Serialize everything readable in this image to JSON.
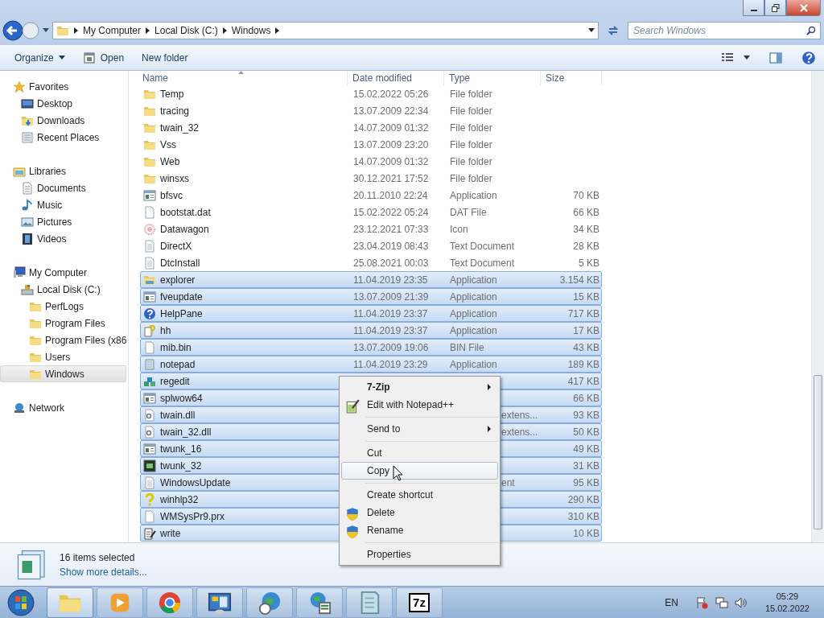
{
  "address": {
    "crumbs": [
      "My Computer",
      "Local Disk (C:)",
      "Windows"
    ]
  },
  "search": {
    "placeholder": "Search Windows"
  },
  "toolbar": {
    "items": [
      {
        "label": "Organize",
        "kind": "menu"
      },
      {
        "label": "Open",
        "kind": "open"
      },
      {
        "label": "New folder",
        "kind": "plain"
      }
    ]
  },
  "sidebar": {
    "groups": [
      {
        "label": "Favorites",
        "kind": "star",
        "selected": false,
        "children": [
          {
            "label": "Desktop",
            "kind": "desktop",
            "selected": false
          },
          {
            "label": "Downloads",
            "kind": "downloads",
            "selected": false
          },
          {
            "label": "Recent Places",
            "kind": "recent",
            "selected": false
          }
        ]
      },
      {
        "label": "Libraries",
        "kind": "library",
        "selected": false,
        "children": [
          {
            "label": "Documents",
            "kind": "documents",
            "selected": false
          },
          {
            "label": "Music",
            "kind": "music",
            "selected": false
          },
          {
            "label": "Pictures",
            "kind": "pictures",
            "selected": false
          },
          {
            "label": "Videos",
            "kind": "videos",
            "selected": false
          }
        ]
      },
      {
        "label": "My Computer",
        "kind": "computer",
        "selected": false,
        "children": [
          {
            "label": "Local Disk (C:)",
            "kind": "drive",
            "selected": false,
            "children": [
              {
                "label": "PerfLogs",
                "kind": "folder",
                "selected": false
              },
              {
                "label": "Program Files",
                "kind": "folder",
                "selected": false
              },
              {
                "label": "Program Files (x86",
                "kind": "folder",
                "selected": false
              },
              {
                "label": "Users",
                "kind": "folder",
                "selected": false
              },
              {
                "label": "Windows",
                "kind": "folder",
                "selected": true
              }
            ]
          }
        ]
      },
      {
        "label": "Network",
        "kind": "network",
        "selected": false
      }
    ]
  },
  "table": {
    "columns": [
      "Name",
      "Date modified",
      "Type",
      "Size"
    ],
    "rows": [
      {
        "name": "Temp",
        "kind": "folder",
        "date": "15.02.2022 05:26",
        "type": "File folder",
        "selected": false
      },
      {
        "name": "tracing",
        "kind": "folder",
        "date": "13.07.2009 22:34",
        "type": "File folder",
        "selected": false
      },
      {
        "name": "twain_32",
        "kind": "folder",
        "date": "14.07.2009 01:32",
        "type": "File folder",
        "selected": false
      },
      {
        "name": "Vss",
        "kind": "folder",
        "date": "13.07.2009 23:20",
        "type": "File folder",
        "selected": false
      },
      {
        "name": "Web",
        "kind": "folder",
        "date": "14.07.2009 01:32",
        "type": "File folder",
        "selected": false
      },
      {
        "name": "winsxs",
        "kind": "folder",
        "date": "30.12.2021 17:52",
        "type": "File folder",
        "selected": false
      },
      {
        "name": "bfsvc",
        "kind": "app",
        "date": "20.11.2010 22:24",
        "type": "Application",
        "size": "70 KB",
        "selected": false
      },
      {
        "name": "bootstat.dat",
        "kind": "file",
        "date": "15.02.2022 05:24",
        "type": "DAT File",
        "size": "66 KB",
        "selected": false
      },
      {
        "name": "Datawagon",
        "kind": "burst",
        "date": "23.12.2021 07:33",
        "type": "Icon",
        "size": "34 KB",
        "selected": false
      },
      {
        "name": "DirectX",
        "kind": "text",
        "date": "23.04.2019 08:43",
        "type": "Text Document",
        "size": "28 KB",
        "selected": false
      },
      {
        "name": "DtcInstall",
        "kind": "text",
        "date": "25.08.2021 00:03",
        "type": "Text Document",
        "size": "5 KB",
        "selected": false
      },
      {
        "name": "explorer",
        "kind": "explorer",
        "date": "11.04.2019 23:35",
        "type": "Application",
        "size": "3.154 KB",
        "selected": true
      },
      {
        "name": "fveupdate",
        "kind": "app",
        "date": "13.07.2009 21:39",
        "type": "Application",
        "size": "15 KB",
        "selected": true
      },
      {
        "name": "HelpPane",
        "kind": "help",
        "date": "11.04.2019 23:37",
        "type": "Application",
        "size": "717 KB",
        "selected": true
      },
      {
        "name": "hh",
        "kind": "hh",
        "date": "11.04.2019 23:37",
        "type": "Application",
        "size": "17 KB",
        "selected": true
      },
      {
        "name": "mib.bin",
        "kind": "file",
        "date": "13.07.2009 19:06",
        "type": "BIN File",
        "size": "43 KB",
        "selected": true
      },
      {
        "name": "notepad",
        "kind": "notepad",
        "date": "11.04.2019 23:29",
        "type": "Application",
        "size": "189 KB",
        "selected": true
      },
      {
        "name": "regedit",
        "kind": "regedit",
        "size": "417 KB",
        "selected": true
      },
      {
        "name": "splwow64",
        "kind": "app",
        "size": "66 KB",
        "selected": true
      },
      {
        "name": "twain.dll",
        "kind": "dll",
        "type": "extens...",
        "size": "93 KB",
        "selected": true
      },
      {
        "name": "twain_32.dll",
        "kind": "dll",
        "type": "extens...",
        "size": "50 KB",
        "selected": true
      },
      {
        "name": "twunk_16",
        "kind": "app",
        "size": "49 KB",
        "selected": true
      },
      {
        "name": "twunk_32",
        "kind": "terminal",
        "size": "31 KB",
        "selected": true
      },
      {
        "name": "WindowsUpdate",
        "kind": "text",
        "type": "ent",
        "size": "95 KB",
        "selected": true
      },
      {
        "name": "winhlp32",
        "kind": "question",
        "size": "290 KB",
        "selected": true
      },
      {
        "name": "WMSysPr9.prx",
        "kind": "file",
        "size": "310 KB",
        "selected": true
      },
      {
        "name": "write",
        "kind": "write",
        "size": "10 KB",
        "selected": true
      }
    ]
  },
  "context_menu": {
    "items": [
      {
        "label": "7-Zip",
        "kind": "submenu",
        "bold": true,
        "selected": false
      },
      {
        "label": "Edit with Notepad++",
        "kind": "notepadpp",
        "selected": false
      },
      {
        "kind": "separator"
      },
      {
        "label": "Send to",
        "kind": "submenu",
        "selected": false
      },
      {
        "kind": "separator"
      },
      {
        "label": "Cut",
        "kind": "plain",
        "selected": false
      },
      {
        "label": "Copy",
        "kind": "plain",
        "selected": true
      },
      {
        "kind": "separator"
      },
      {
        "label": "Create shortcut",
        "kind": "plain",
        "selected": false
      },
      {
        "label": "Delete",
        "kind": "shield",
        "selected": false
      },
      {
        "label": "Rename",
        "kind": "shield",
        "selected": false
      },
      {
        "kind": "separator"
      },
      {
        "label": "Properties",
        "kind": "plain",
        "selected": false
      }
    ]
  },
  "details": {
    "summary": "16 items selected",
    "link": "Show more details..."
  },
  "taskbar": {
    "apps": [
      {
        "kind": "explorer",
        "selected": true
      },
      {
        "kind": "media",
        "selected": false
      },
      {
        "kind": "chrome",
        "selected": false
      },
      {
        "kind": "panel",
        "selected": false
      },
      {
        "kind": "globe-clock",
        "selected": false
      },
      {
        "kind": "globe-check",
        "selected": false
      },
      {
        "kind": "notepad",
        "selected": false
      },
      {
        "kind": "sevenzip",
        "label": "7z",
        "selected": false
      }
    ],
    "language": "EN",
    "time": "05:29",
    "date": "15.02.2022"
  }
}
